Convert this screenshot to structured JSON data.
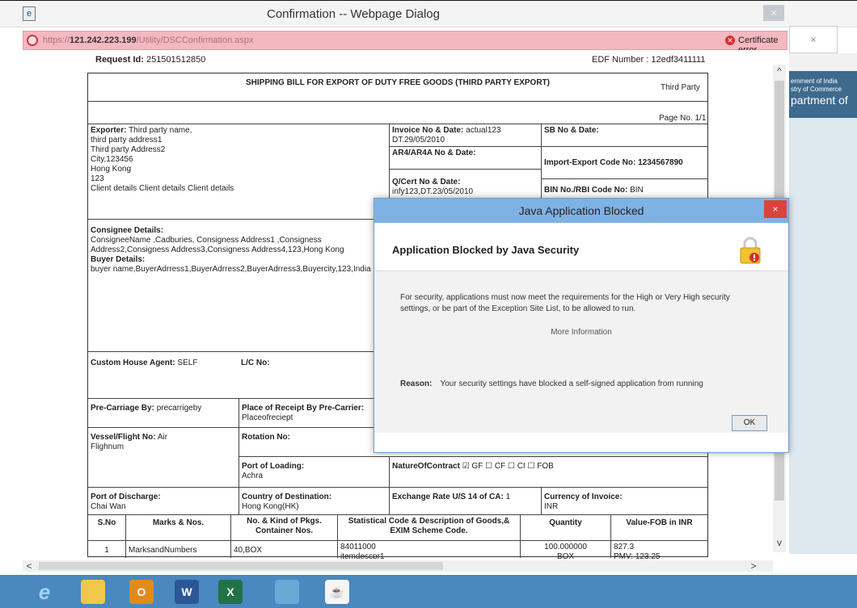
{
  "window": {
    "title": "Confirmation -- Webpage Dialog",
    "close_glyph": "×"
  },
  "address": {
    "url_prefix": "https://",
    "url_host": "121.242.223.199",
    "url_path": "/Utility/DSCConfirmation.aspx",
    "cert_error": "Certificate error",
    "cert_icon": "certificate-error-icon"
  },
  "background_tab": {
    "close_glyph": "×",
    "banner_line1": "ernment of India",
    "banner_line2": "stry of Commerce",
    "banner_line3": "partment of"
  },
  "header": {
    "request_label": "Request Id:",
    "request_id": "251501512850",
    "edf_label": "EDF Number : 12edf3411111"
  },
  "document": {
    "title": "SHIPPING BILL FOR EXPORT OF DUTY FREE GOODS (THIRD PARTY EXPORT)",
    "party_type": "Third Party",
    "page_no": "Page No. 1/1",
    "exporter_label": "Exporter:",
    "exporter_name": "Third party name,",
    "exporter_lines": [
      "third party address1",
      "Third party Address2",
      "City,123456",
      "Hong Kong",
      "123",
      "Client details Client details Client details"
    ],
    "invoice_label": "Invoice No & Date:",
    "invoice_value": "actual123",
    "invoice_date": "DT.29/05/2010",
    "sb_label": "SB No & Date:",
    "ar4_label": "AR4/AR4A No & Date:",
    "iec_label": "Import-Export Code No:",
    "iec_value": "1234567890",
    "qcert_label": "Q/Cert No & Date:",
    "qcert_value": "infy123,DT.23/05/2010",
    "bin_label": "BIN No./RBI Code No:",
    "bin_value": "BIN",
    "consignee_label": "Consignee Details:",
    "consignee_value": "ConsigneeName ,Cadburies, Consigness Address1 ,Consigness Address2,Consigness Address3,Consigness Address4,123,Hong Kong",
    "buyer_label": "Buyer Details:",
    "buyer_value": "buyer name,BuyerAdrress1,BuyerAdrress2,BuyerAdrress3,Buyercity,123,India",
    "cha_label": "Custom House Agent:",
    "cha_value": "SELF",
    "lc_label": "L/C No:",
    "precarriage_label": "Pre-Carriage By:",
    "precarriage_value": "precarrigeby",
    "receipt_label": "Place of Receipt By Pre-Carrier:",
    "receipt_value": "Placeofreciept",
    "vessel_label": "Vessel/Flight No:",
    "vessel_value": "Air",
    "vessel_sub": "Flighnum",
    "rotation_label": "Rotation No:",
    "loading_label": "Port of Loading:",
    "loading_value": "Achra",
    "nature_label": "NatureOfContract",
    "nature_options": [
      "☑ GF",
      "☐ CF",
      "☐ CI",
      "☐ FOB"
    ],
    "discharge_label": "Port of Discharge:",
    "discharge_value": "Chai Wan",
    "destination_label": "Country of Destination:",
    "destination_value": "Hong Kong(HK)",
    "exchange_label": "Exchange Rate U/S 14 of CA:",
    "exchange_value": "1",
    "currency_label": "Currency of Invoice:",
    "currency_value": "INR",
    "table_headers": [
      "S.No",
      "Marks & Nos.",
      "No. & Kind of Pkgs. Container Nos.",
      "Statistical Code & Description of Goods,& EXIM Scheme Code.",
      "Quantity",
      "Value-FOB in INR"
    ],
    "row": {
      "sno": "1",
      "marks": "MarksandNumbers",
      "pkgs": "40,BOX",
      "code": "84011000",
      "desc": "itemdescpr1",
      "qty": "100.000000",
      "qty_unit": "BOX",
      "fob": "827.3",
      "pmv": "PMV: 123.25"
    }
  },
  "java_dialog": {
    "title": "Java Application Blocked",
    "close_glyph": "×",
    "heading": "Application Blocked by Java Security",
    "message": "For security, applications must now meet the requirements for the High or Very High security settings, or be part of the Exception Site List, to be allowed to run.",
    "more_info": "More Information",
    "reason_label": "Reason:",
    "reason_text": "Your security settings have blocked a self-signed application from running",
    "ok_label": "OK",
    "icon": "padlock-warning-icon"
  },
  "scrollbars": {
    "up": "^",
    "down": "v",
    "left": "<",
    "right": ">"
  },
  "taskbar": {
    "items": [
      {
        "name": "internet-explorer-icon",
        "glyph": "e",
        "color": "#1f7fd6"
      },
      {
        "name": "file-explorer-icon",
        "glyph": "",
        "color": "#f0c84a"
      },
      {
        "name": "outlook-icon",
        "glyph": "O",
        "color": "#e08a1c"
      },
      {
        "name": "word-icon",
        "glyph": "W",
        "color": "#2b5797"
      },
      {
        "name": "excel-icon",
        "glyph": "X",
        "color": "#217346"
      },
      {
        "name": "control-panel-icon",
        "glyph": "",
        "color": "#6aa8d8"
      },
      {
        "name": "java-icon",
        "glyph": "☕",
        "color": "#d96b2b"
      }
    ]
  }
}
